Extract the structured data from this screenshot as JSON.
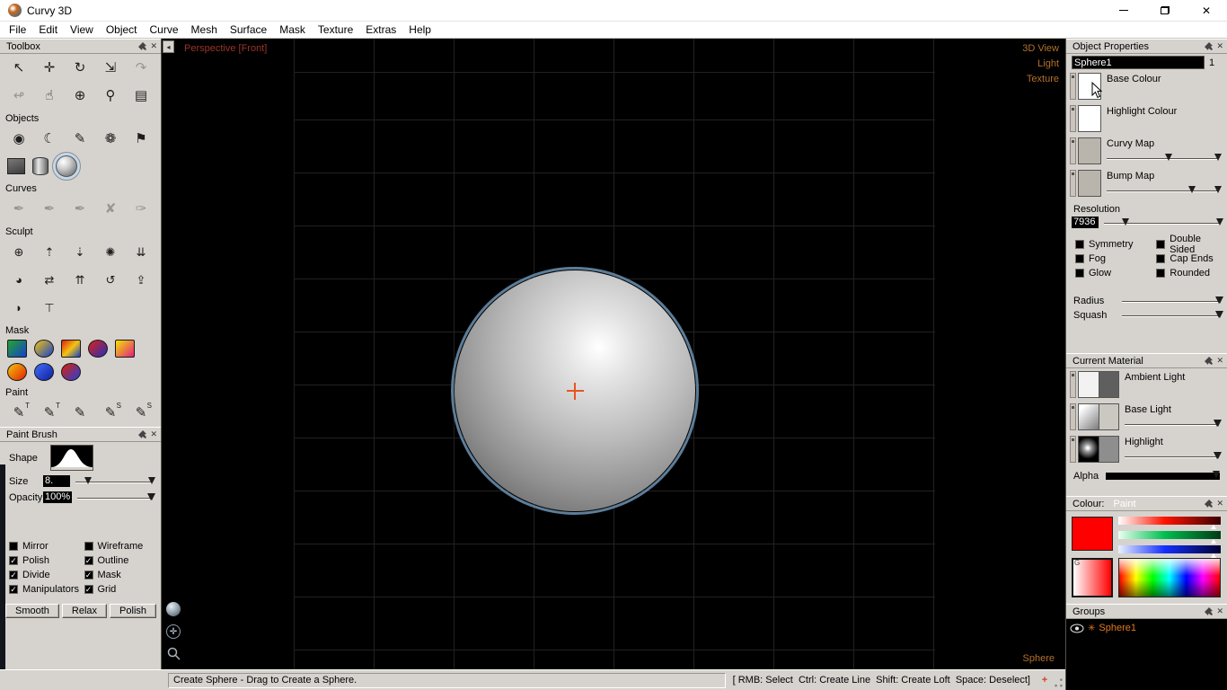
{
  "window": {
    "title": "Curvy 3D"
  },
  "menu": {
    "items": [
      "File",
      "Edit",
      "View",
      "Object",
      "Curve",
      "Mesh",
      "Surface",
      "Mask",
      "Texture",
      "Extras",
      "Help"
    ]
  },
  "icons": {
    "close": "✕",
    "dock_arrow": "◂",
    "compass": "✛",
    "star": "✳",
    "plus_target": "+"
  },
  "toolbox": {
    "title": "Toolbox",
    "tools_row1": [
      {
        "name": "select-tool",
        "glyph": "↖"
      },
      {
        "name": "move-tool",
        "glyph": "✛"
      },
      {
        "name": "rotate-tool",
        "glyph": "↻"
      },
      {
        "name": "scale-tool",
        "glyph": "⇲"
      },
      {
        "name": "redo-tool",
        "glyph": "↷",
        "state": "disabled"
      }
    ],
    "tools_row2": [
      {
        "name": "lathe-tool",
        "glyph": "↫",
        "state": "disabled"
      },
      {
        "name": "pan-tool",
        "glyph": "☝"
      },
      {
        "name": "focus-tool",
        "glyph": "⊕"
      },
      {
        "name": "zoom-tool",
        "glyph": "⚲"
      },
      {
        "name": "notes-tool",
        "glyph": "▤"
      }
    ],
    "objects_label": "Objects",
    "objects_row1": [
      {
        "name": "blob-object-tool",
        "glyph": "◉"
      },
      {
        "name": "curve-object-tool",
        "glyph": "☾"
      },
      {
        "name": "lathe-object-tool",
        "glyph": "✎"
      },
      {
        "name": "twist-object-tool",
        "glyph": "❁"
      },
      {
        "name": "plane-object-tool",
        "glyph": "⚑"
      }
    ],
    "objects_row2": [
      {
        "name": "cube-primitive-tool",
        "shape": "cube"
      },
      {
        "name": "cylinder-primitive-tool",
        "shape": "cylinder"
      },
      {
        "name": "sphere-primitive-tool",
        "shape": "sphere",
        "state": "selected"
      }
    ],
    "curves_label": "Curves",
    "curves_row": [
      {
        "name": "curve-draw-tool",
        "glyph": "✒",
        "state": "disabled"
      },
      {
        "name": "curve-smooth-tool",
        "glyph": "✒",
        "state": "disabled"
      },
      {
        "name": "curve-sharpen-tool",
        "glyph": "✒",
        "state": "disabled"
      },
      {
        "name": "curve-delete-tool",
        "glyph": "✘",
        "state": "disabled"
      },
      {
        "name": "curve-edit-tool",
        "glyph": "✑",
        "state": "disabled"
      }
    ],
    "sculpt_label": "Sculpt",
    "sculpt_row1": [
      {
        "name": "sculpt-sphere-tool",
        "glyph": "⊕"
      },
      {
        "name": "sculpt-raise-tool",
        "glyph": "⇡"
      },
      {
        "name": "sculpt-lower-tool",
        "glyph": "⇣"
      },
      {
        "name": "sculpt-spike-tool",
        "glyph": "✺"
      },
      {
        "name": "sculpt-dent-tool",
        "glyph": "⇊"
      }
    ],
    "sculpt_row2": [
      {
        "name": "sculpt-inflate-tool",
        "glyph": "◕"
      },
      {
        "name": "sculpt-pinch-tool",
        "glyph": "⇄"
      },
      {
        "name": "sculpt-grow-tool",
        "glyph": "⇈"
      },
      {
        "name": "sculpt-smooth-tool",
        "glyph": "↺"
      },
      {
        "name": "sculpt-lift-tool",
        "glyph": "⇪"
      }
    ],
    "sculpt_row3": [
      {
        "name": "sculpt-wax-tool",
        "glyph": "◗"
      },
      {
        "name": "sculpt-flatten-tool",
        "glyph": "⊤"
      }
    ],
    "mask_label": "Mask",
    "mask_row1": [
      {
        "name": "mask-cube-green-blue-tool",
        "colors": [
          "#24a42c",
          "#1440cc"
        ]
      },
      {
        "name": "mask-sphere-yellow-blue-tool",
        "colors": [
          "#f4c410",
          "#1440cc"
        ],
        "shape": "round"
      },
      {
        "name": "mask-swirl-rainbow-tool",
        "colors": [
          "#e02010",
          "#f4c410",
          "#1440cc"
        ]
      },
      {
        "name": "mask-disc-red-blue-tool",
        "colors": [
          "#e02010",
          "#2030c0"
        ],
        "shape": "round"
      },
      {
        "name": "mask-cylinder-yellow-magenta-tool",
        "colors": [
          "#f4e400",
          "#e02080"
        ]
      }
    ],
    "mask_row2": [
      {
        "name": "mask-fire-tool",
        "colors": [
          "#f4c410",
          "#e02000"
        ],
        "shape": "round"
      },
      {
        "name": "mask-blue-tool",
        "colors": [
          "#4070f8",
          "#101ea0"
        ],
        "shape": "round"
      },
      {
        "name": "mask-split-tool",
        "colors": [
          "#e02000",
          "#2040e0"
        ],
        "shape": "round"
      }
    ],
    "paint_label": "Paint",
    "paint_row": [
      {
        "name": "paint-texture-tool",
        "glyph": "✎",
        "letter": "T"
      },
      {
        "name": "paint-texture-alt-tool",
        "glyph": "✎",
        "letter": "T"
      },
      {
        "name": "paint-brush-tool",
        "glyph": "✎"
      },
      {
        "name": "paint-smear-tool",
        "glyph": "✎",
        "letter": "S"
      },
      {
        "name": "paint-smudge-tool",
        "glyph": "✎",
        "letter": "S"
      }
    ]
  },
  "paint_brush": {
    "title": "Paint Brush",
    "shape_label": "Shape",
    "size_label": "Size",
    "size_value": "8.",
    "opacity_label": "Opacity",
    "opacity_value": "100%",
    "checks_left": [
      {
        "name": "mirror-checkbox",
        "label": "Mirror",
        "checked": false
      },
      {
        "name": "polish-checkbox",
        "label": "Polish",
        "checked": true
      },
      {
        "name": "divide-checkbox",
        "label": "Divide",
        "checked": true
      },
      {
        "name": "manipulators-checkbox",
        "label": "Manipulators",
        "checked": true
      }
    ],
    "checks_right": [
      {
        "name": "wireframe-checkbox",
        "label": "Wireframe",
        "checked": false
      },
      {
        "name": "outline-checkbox",
        "label": "Outline",
        "checked": true
      },
      {
        "name": "mask-checkbox",
        "label": "Mask",
        "checked": true
      },
      {
        "name": "grid-checkbox",
        "label": "Grid",
        "checked": true
      }
    ],
    "buttons": [
      "Smooth",
      "Relax",
      "Polish"
    ]
  },
  "viewport": {
    "view_label": "Perspective [Front]",
    "view_label_color": "#9c342a",
    "mode_links": [
      "3D View",
      "Light",
      "Texture"
    ],
    "mode_color": "#b4702a",
    "tool_label": "Sphere",
    "crosshair_color": "#e85520",
    "sphere_outline_color": "#5c7d99"
  },
  "object_properties": {
    "title": "Object Properties",
    "name_value": "Sphere1",
    "count": "1",
    "base_colour_label": "Base Colour",
    "highlight_colour_label": "Highlight Colour",
    "curvy_map_label": "Curvy Map",
    "bump_map_label": "Bump Map",
    "resolution_label": "Resolution",
    "resolution_value": "7936",
    "checks_left": [
      {
        "name": "symmetry-checkbox",
        "label": "Symmetry",
        "checked": false
      },
      {
        "name": "fog-checkbox",
        "label": "Fog",
        "checked": false
      },
      {
        "name": "glow-checkbox",
        "label": "Glow",
        "checked": false
      }
    ],
    "checks_right": [
      {
        "name": "double-sided-checkbox",
        "label": "Double Sided",
        "checked": false
      },
      {
        "name": "cap-ends-checkbox",
        "label": "Cap Ends",
        "checked": false
      },
      {
        "name": "rounded-checkbox",
        "label": "Rounded",
        "checked": false
      }
    ],
    "radius_label": "Radius",
    "squash_label": "Squash"
  },
  "current_material": {
    "title": "Current Material",
    "ambient_label": "Ambient Light",
    "base_label": "Base Light",
    "highlight_label": "Highlight",
    "alpha_label": "Alpha"
  },
  "colour_panel": {
    "title": "Colour:",
    "mode": "Paint",
    "current_colour": "#ff0000",
    "corner_label": "G"
  },
  "groups": {
    "title": "Groups",
    "items": [
      {
        "name": "group-sphere1",
        "label": "Sphere1"
      }
    ]
  },
  "status_bar": {
    "message": "Create Sphere - Drag to Create a Sphere.",
    "hints": "[ RMB: Select  Ctrl: Create Line  Shift: Create Loft  Space: Deselect]"
  },
  "sliders": {
    "curvy_map": 55,
    "bump_map": 75,
    "resolution": 18,
    "radius": 97,
    "squash": 97,
    "base_light": 97,
    "highlight": 97,
    "alpha": 97,
    "size": 16,
    "opacity": 97
  }
}
